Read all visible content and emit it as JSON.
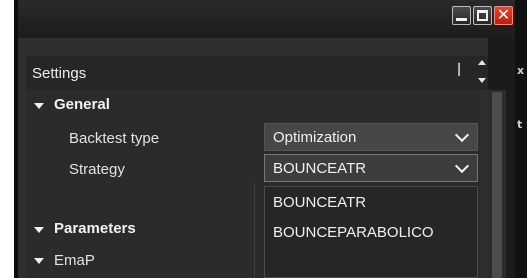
{
  "window": {
    "controls": {
      "minimize_icon": "minimize-icon",
      "maximize_icon": "maximize-icon",
      "close_icon": "close-icon",
      "close_glyph": "✕"
    },
    "close_color": "#d7311c"
  },
  "settings": {
    "title": "Settings",
    "pin_icon": "pin-icon"
  },
  "grid": {
    "categories": [
      {
        "label": "General",
        "expanded": true
      },
      {
        "label": "Parameters",
        "expanded": true
      }
    ],
    "properties": [
      {
        "label": "Backtest type",
        "value": "Optimization"
      },
      {
        "label": "Strategy",
        "value": "BOUNCEATR"
      }
    ],
    "subgroup": {
      "label": "EmaP",
      "expanded": true
    },
    "dropdown_options": [
      "BOUNCEATR",
      "BOUNCEPARABOLICO"
    ]
  }
}
